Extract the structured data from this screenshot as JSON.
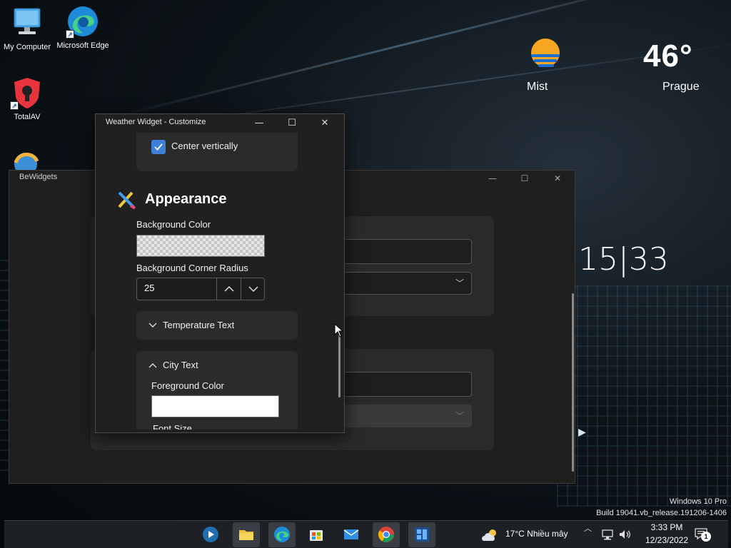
{
  "desktop": {
    "icons": [
      {
        "label": "My Computer"
      },
      {
        "label": "Microsoft Edge"
      },
      {
        "label": "TotalAV"
      },
      {
        "label": "BeWidgets"
      }
    ]
  },
  "weather_widget": {
    "temperature": "46°",
    "condition": "Mist",
    "city": "Prague"
  },
  "clock_widget": {
    "time": "15|33"
  },
  "bewidgets_window": {
    "title": "BeWidgets",
    "minimize": "—",
    "maximize": "☐",
    "close": "✕"
  },
  "customize_window": {
    "title": "Weather Widget - Customize",
    "minimize": "—",
    "maximize": "☐",
    "close": "✕",
    "center_vertically": {
      "label": "Center vertically",
      "checked": true
    },
    "appearance": {
      "title": "Appearance",
      "background_color_label": "Background Color",
      "corner_radius_label": "Background Corner Radius",
      "corner_radius_value": "25",
      "temperature_text_label": "Temperature Text",
      "city_text_label": "City Text",
      "foreground_color_label": "Foreground Color",
      "font_size_label": "Font Size"
    }
  },
  "watermark": {
    "line1": "Windows 10 Pro",
    "line2": "Build 19041.vb_release.191206-1406"
  },
  "taskbar": {
    "apps": [
      {
        "name": "media-player-icon"
      },
      {
        "name": "file-explorer-icon"
      },
      {
        "name": "edge-icon"
      },
      {
        "name": "store-icon"
      },
      {
        "name": "mail-icon"
      },
      {
        "name": "chrome-icon"
      },
      {
        "name": "bewidgets-icon"
      }
    ],
    "weather": "17°C  Nhiều mây",
    "time": "3:33 PM",
    "date": "12/23/2022",
    "notification_count": "1"
  }
}
